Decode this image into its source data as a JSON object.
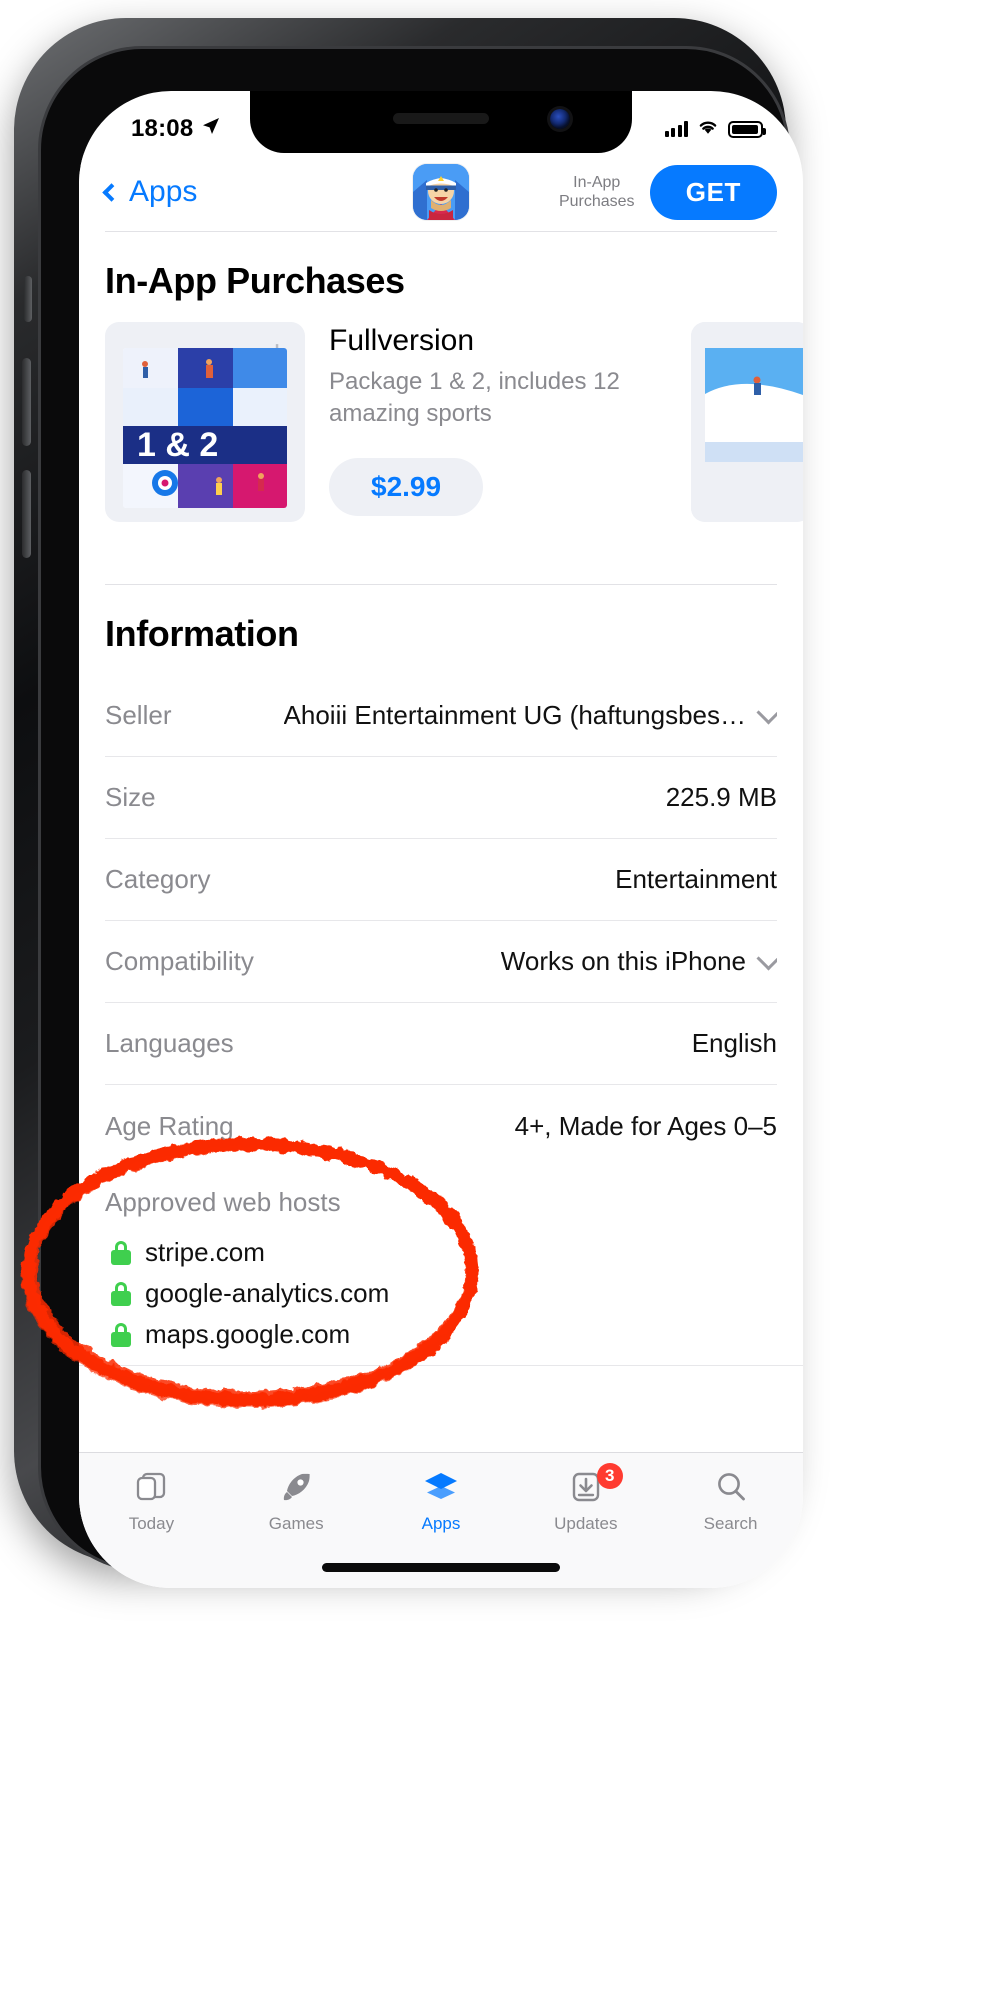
{
  "status_bar": {
    "time": "18:08",
    "location_icon": "location-arrow-icon",
    "signal_icon": "cellular-bars-icon",
    "wifi_icon": "wifi-icon",
    "battery_icon": "battery-icon"
  },
  "navbar": {
    "back_label": "Apps",
    "back_icon": "chevron-left-icon",
    "app_icon": "app-icon-captain",
    "iap_label": "In-App\nPurchases",
    "iap_label_line1": "In-App",
    "iap_label_line2": "Purchases",
    "get_label": "GET"
  },
  "in_app_purchases": {
    "section_title": "In-App Purchases",
    "item": {
      "name": "Fullversion",
      "description": "Package 1 & 2, includes 12 amazing sports",
      "price": "$2.99",
      "thumb_caption": "1 & 2",
      "add_icon": "plus-icon"
    }
  },
  "information": {
    "section_title": "Information",
    "rows": [
      {
        "key": "Seller",
        "value": "Ahoiii Entertainment UG (haftungsbes…",
        "disclosure": true
      },
      {
        "key": "Size",
        "value": "225.9 MB",
        "disclosure": false
      },
      {
        "key": "Category",
        "value": "Entertainment",
        "disclosure": false
      },
      {
        "key": "Compatibility",
        "value": "Works on this iPhone",
        "disclosure": true
      },
      {
        "key": "Languages",
        "value": "English",
        "disclosure": false
      },
      {
        "key": "Age Rating",
        "value": "4+, Made for Ages 0–5",
        "disclosure": false
      }
    ],
    "approved_web_hosts": {
      "title": "Approved web hosts",
      "lock_icon": "lock-icon",
      "hosts": [
        "stripe.com",
        "google-analytics.com",
        "maps.google.com"
      ]
    }
  },
  "tabbar": {
    "tabs": [
      {
        "label": "Today",
        "icon": "today-cards-icon",
        "active": false,
        "badge": ""
      },
      {
        "label": "Games",
        "icon": "rocket-icon",
        "active": false,
        "badge": ""
      },
      {
        "label": "Apps",
        "icon": "layers-stack-icon",
        "active": true,
        "badge": ""
      },
      {
        "label": "Updates",
        "icon": "download-arrow-icon",
        "active": false,
        "badge": "3"
      },
      {
        "label": "Search",
        "icon": "magnifier-icon",
        "active": false,
        "badge": ""
      }
    ]
  },
  "annotation": {
    "shape": "red-ellipse-highlight",
    "color": "#FB2B06",
    "target": "Approved web hosts"
  },
  "colors": {
    "accent_blue": "#067AFF",
    "badge_red": "#FF3B30",
    "lock_green": "#3FCF4E",
    "muted_gray": "#8A8A8F",
    "annotation_red": "#FB2B06"
  }
}
